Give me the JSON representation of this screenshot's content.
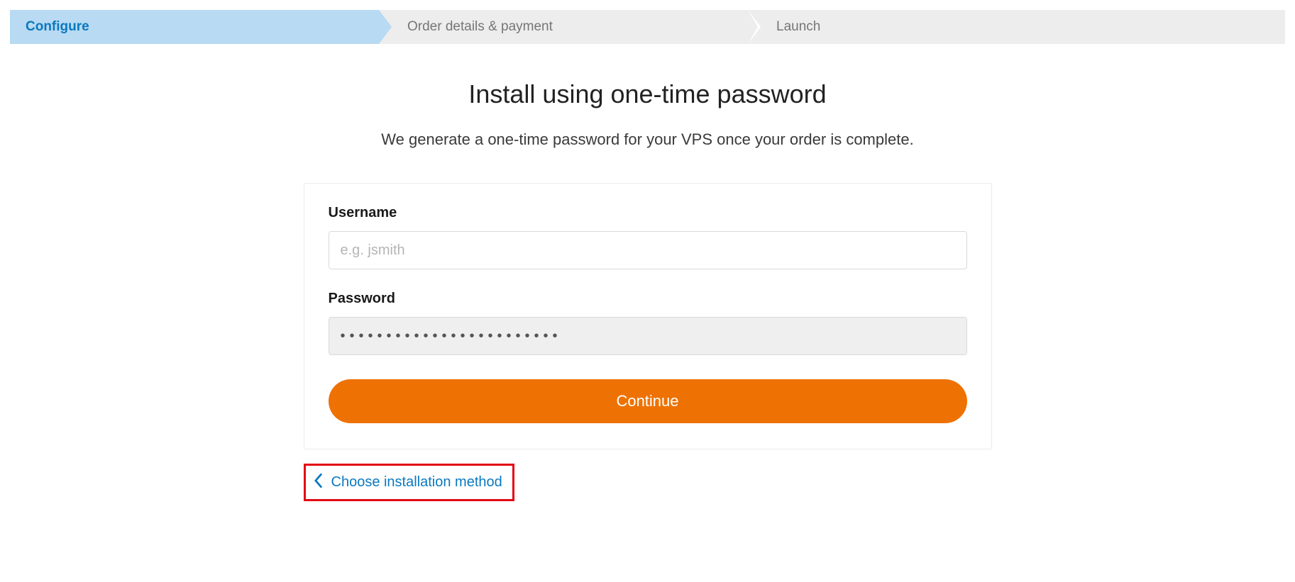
{
  "stepper": {
    "step1": "Configure",
    "step2": "Order details & payment",
    "step3": "Launch"
  },
  "page": {
    "title": "Install using one-time password",
    "subtitle": "We generate a one-time password for your VPS once your order is complete."
  },
  "form": {
    "username_label": "Username",
    "username_placeholder": "e.g. jsmith",
    "username_value": "",
    "password_label": "Password",
    "password_value": "••••••••••••••••••••••••",
    "continue_label": "Continue"
  },
  "back_link": {
    "label": "Choose installation method"
  }
}
